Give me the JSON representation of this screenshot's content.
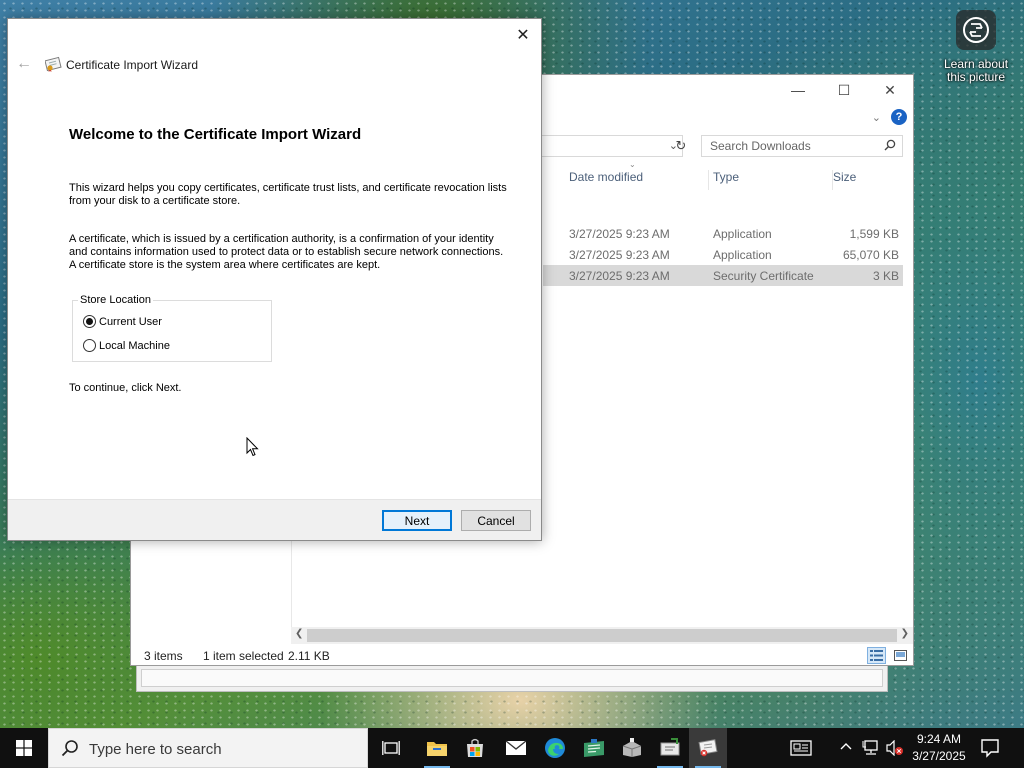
{
  "desktop": {
    "learn_widget": {
      "label": "Learn about this picture"
    }
  },
  "explorer": {
    "search_placeholder": "Search Downloads",
    "columns": {
      "date": "Date modified",
      "type": "Type",
      "size": "Size"
    },
    "rows": [
      {
        "date": "3/27/2025 9:23 AM",
        "type": "Application",
        "size": "1,599 KB",
        "selected": false
      },
      {
        "date": "3/27/2025 9:23 AM",
        "type": "Application",
        "size": "65,070 KB",
        "selected": false
      },
      {
        "date": "3/27/2025 9:23 AM",
        "type": "Security Certificate",
        "size": "3 KB",
        "selected": true
      }
    ],
    "status": {
      "items": "3 items",
      "selected": "1 item selected",
      "size": "2.11 KB"
    }
  },
  "wizard": {
    "title": "Certificate Import Wizard",
    "heading": "Welcome to the Certificate Import Wizard",
    "paragraph1": "This wizard helps you copy certificates, certificate trust lists, and certificate revocation lists from your disk to a certificate store.",
    "paragraph2": "A certificate, which is issued by a certification authority, is a confirmation of your identity and contains information used to protect data or to establish secure network connections. A certificate store is the system area where certificates are kept.",
    "store_location": {
      "legend": "Store Location",
      "options": [
        {
          "label": "Current User",
          "selected": true
        },
        {
          "label": "Local Machine",
          "selected": false
        }
      ]
    },
    "continue_text": "To continue, click Next.",
    "buttons": {
      "next": "Next",
      "cancel": "Cancel"
    }
  },
  "taskbar": {
    "search_placeholder": "Type here to search",
    "clock": {
      "time": "9:24 AM",
      "date": "3/27/2025"
    },
    "apps": [
      "task-view-icon",
      "file-explorer-icon",
      "store-icon",
      "mail-icon",
      "edge-icon",
      "app-icon",
      "app-icon",
      "app-icon",
      "certificate-wizard-icon"
    ]
  }
}
